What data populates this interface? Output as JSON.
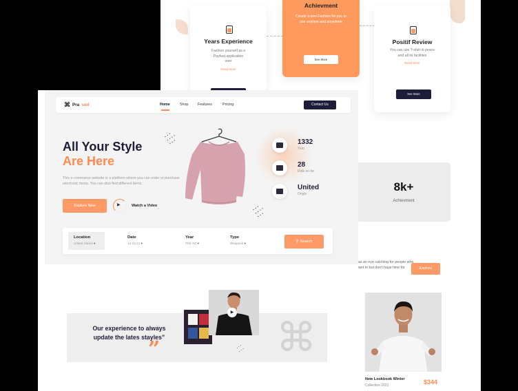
{
  "back_page": {
    "cards": [
      {
        "title": "Years Experience",
        "text": "Fashion yourself as a Payfast application user",
        "link": "Read More"
      },
      {
        "title": "Achievment",
        "text": "Create a new Fashion for you to use anytime and anywhere",
        "button": "See More"
      },
      {
        "title": "Positif Review",
        "text": "You can use T-shirt in peace and all its facilities",
        "link": "Read More",
        "button": "See More"
      }
    ],
    "stat": {
      "value": "8k+",
      "label": "Achievment"
    },
    "promo_text": "has an eye catching for people who want to but don't have time for",
    "explore_label": "Explore",
    "product": {
      "title": "New Lookbook Winter",
      "subtitle": "Collection 2021",
      "price": "$344"
    }
  },
  "front_page": {
    "brand": {
      "prefix": "Pra",
      "accent": "sud"
    },
    "nav": [
      "Home",
      "Shop",
      "Features",
      "Pricing"
    ],
    "contact_label": "Contact Us",
    "hero": {
      "title_line1": "All Your Style",
      "title_line2": "Are Here",
      "description": "This e-commerce website is a platform where you can order or purchase electronic items. You can also find different items.",
      "explore_label": "Explore Now",
      "watch_label": "Watch a Video"
    },
    "stats": [
      {
        "value": "1332",
        "label": "Year",
        "icon": "calendar-icon"
      },
      {
        "value": "28",
        "label": "Ride so far",
        "icon": "users-icon"
      },
      {
        "value": "United",
        "label": "Origin",
        "icon": "building-icon"
      }
    ],
    "search": {
      "fields": [
        {
          "label": "Location",
          "value": "United Stated"
        },
        {
          "label": "Date",
          "value": "14-12-21"
        },
        {
          "label": "Year",
          "value": "TKE AD"
        },
        {
          "label": "Type",
          "value": "Weapons"
        }
      ],
      "button": "Search"
    },
    "quote": {
      "text": "Our experience to always update the lates stayles”",
      "mark": "”"
    }
  },
  "colors": {
    "accent": "#ff8a50",
    "navy": "#1d1d3a"
  }
}
